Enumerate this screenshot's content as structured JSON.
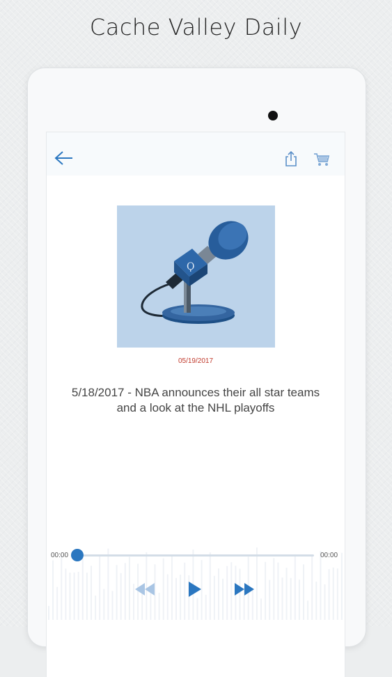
{
  "promo": {
    "title": "Cache Valley Daily"
  },
  "app_bar": {
    "back_icon": "arrow-left-icon",
    "share_icon": "share-icon",
    "cart_icon": "cart-icon"
  },
  "episode": {
    "artwork_icon": "microphone-icon",
    "date": "05/19/2017",
    "title": "5/18/2017 - NBA announces their all star teams and a look at the NHL playoffs"
  },
  "player": {
    "elapsed": "00:00",
    "duration": "00:00",
    "progress": 0,
    "controls": {
      "rewind_icon": "rewind-icon",
      "play_icon": "play-icon",
      "forward_icon": "fast-forward-icon"
    }
  },
  "colors": {
    "accent": "#2b77c0",
    "date_red": "#c0392b",
    "artwork_bg": "#bcd3ea",
    "text": "#444444"
  }
}
